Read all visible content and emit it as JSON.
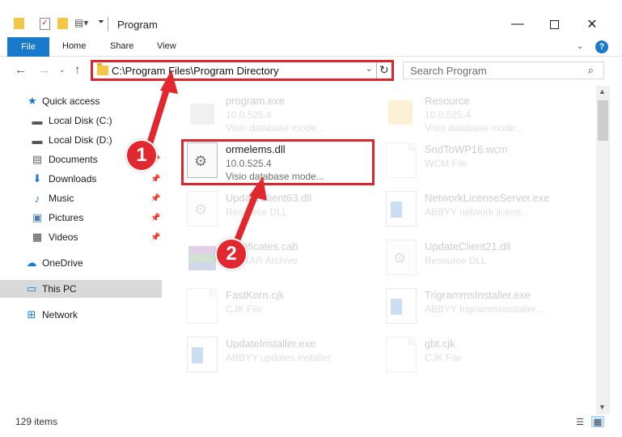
{
  "window": {
    "title": "Program",
    "minimize_icon": "minimize-icon",
    "maximize_icon": "maximize-icon",
    "close_icon": "close-icon"
  },
  "ribbon": {
    "tabs": [
      "File",
      "Home",
      "Share",
      "View"
    ],
    "help": "?"
  },
  "address": {
    "path": "C:\\Program Files\\Program Directory",
    "dropdown": "⌄",
    "refresh": "↻"
  },
  "search": {
    "placeholder": "Search Program",
    "icon": "⌕"
  },
  "sidebar": {
    "items": [
      {
        "label": "Quick access",
        "icon": "★",
        "pinned": false
      },
      {
        "label": "Local Disk (C:)",
        "icon": "▬",
        "pinned": false
      },
      {
        "label": "Local Disk (D:)",
        "icon": "▬",
        "pinned": false
      },
      {
        "label": "Documents",
        "icon": "▤",
        "pinned": true
      },
      {
        "label": "Downloads",
        "icon": "⬇",
        "pinned": true
      },
      {
        "label": "Music",
        "icon": "♪",
        "pinned": true
      },
      {
        "label": "Pictures",
        "icon": "▣",
        "pinned": true
      },
      {
        "label": "Videos",
        "icon": "▦",
        "pinned": true
      },
      {
        "label": "OneDrive",
        "icon": "☁",
        "pinned": false
      },
      {
        "label": "This PC",
        "icon": "▭",
        "pinned": false
      },
      {
        "label": "Network",
        "icon": "⊞",
        "pinned": false
      }
    ]
  },
  "files": [
    {
      "name": "program.exe",
      "line2": "10.0.525.4",
      "line3": "Visio database mode...",
      "icon": "exe"
    },
    {
      "name": "Resource",
      "line2": "10.0.525.4",
      "line3": "Visio database mode...",
      "icon": "folder"
    },
    {
      "name": "ormelems.dll",
      "line2": "10.0.525.4",
      "line3": "Visio database mode...",
      "icon": "gear"
    },
    {
      "name": "SndToWP16.wcm",
      "line2": "WCM File",
      "line3": "",
      "icon": "doc"
    },
    {
      "name": "UpdateClient63.dll",
      "line2": "Resource DLL",
      "line3": "",
      "icon": "gear"
    },
    {
      "name": "NetworkLicenseServer.exe",
      "line2": "ABBYY network licens...",
      "line3": "",
      "icon": "blue"
    },
    {
      "name": "Certificates.cab",
      "line2": "WinRAR Archive",
      "line3": "",
      "icon": "cab"
    },
    {
      "name": "UpdateClient21.dll",
      "line2": "Resource DLL",
      "line3": "",
      "icon": "gear"
    },
    {
      "name": "FastKorn.cjk",
      "line2": "CJK File",
      "line3": "",
      "icon": "doc"
    },
    {
      "name": "TrigrammsInstaller.exe",
      "line2": "ABBYY trigrammsinstaller ...",
      "line3": "",
      "icon": "blue"
    },
    {
      "name": "UpdateInstaller.exe",
      "line2": "ABBYY updates installer",
      "line3": "",
      "icon": "blue"
    },
    {
      "name": "gbt.cjk",
      "line2": "CJK File",
      "line3": "",
      "icon": "doc"
    }
  ],
  "status": {
    "count": "129 items"
  },
  "callouts": {
    "one": "1",
    "two": "2"
  },
  "colors": {
    "accent": "#1979ca",
    "highlight_red": "#d9272e",
    "marker_red": "#e1282e",
    "selected_bg": "#d9d9d9"
  }
}
